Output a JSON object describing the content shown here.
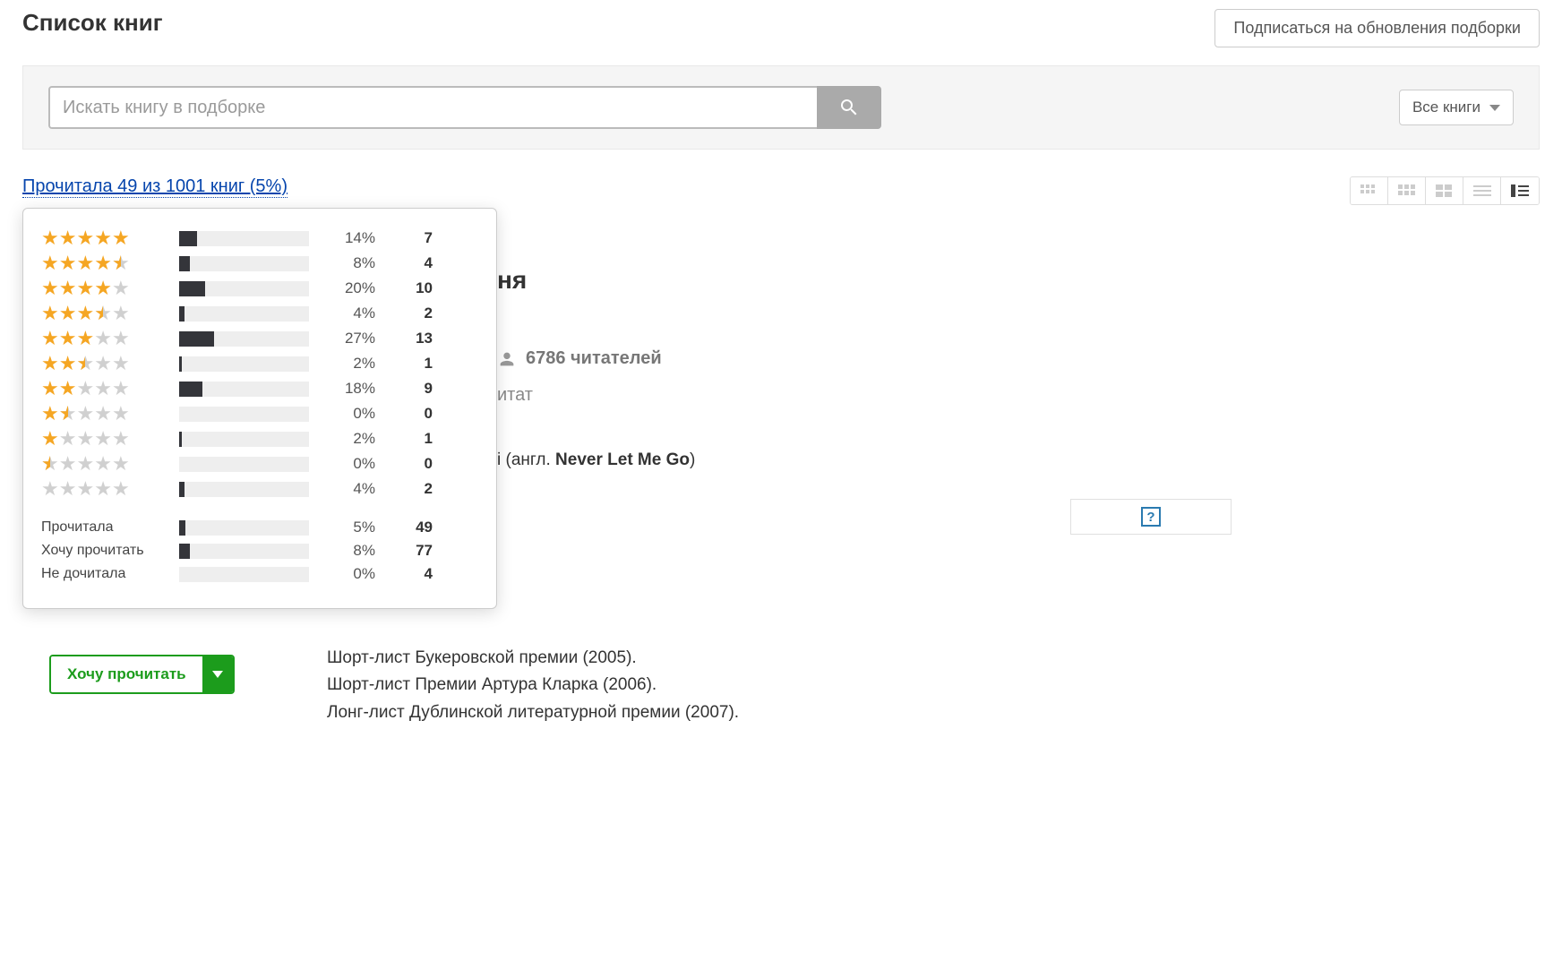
{
  "header": {
    "title": "Список книг",
    "subscribe": "Подписаться на обновления подборки"
  },
  "search": {
    "placeholder": "Искать книгу в подборке",
    "filter_label": "Все книги"
  },
  "progress_link": "Прочитала 49 из 1001 книг (5%)",
  "rating_rows": [
    {
      "stars_full": 5,
      "stars_half": 0,
      "pct": "14%",
      "cnt": "7",
      "bar": 14
    },
    {
      "stars_full": 4,
      "stars_half": 1,
      "pct": "8%",
      "cnt": "4",
      "bar": 8
    },
    {
      "stars_full": 4,
      "stars_half": 0,
      "pct": "20%",
      "cnt": "10",
      "bar": 20
    },
    {
      "stars_full": 3,
      "stars_half": 1,
      "pct": "4%",
      "cnt": "2",
      "bar": 4
    },
    {
      "stars_full": 3,
      "stars_half": 0,
      "pct": "27%",
      "cnt": "13",
      "bar": 27
    },
    {
      "stars_full": 2,
      "stars_half": 1,
      "pct": "2%",
      "cnt": "1",
      "bar": 2
    },
    {
      "stars_full": 2,
      "stars_half": 0,
      "pct": "18%",
      "cnt": "9",
      "bar": 18
    },
    {
      "stars_full": 1,
      "stars_half": 1,
      "pct": "0%",
      "cnt": "0",
      "bar": 0
    },
    {
      "stars_full": 1,
      "stars_half": 0,
      "pct": "2%",
      "cnt": "1",
      "bar": 2
    },
    {
      "stars_full": 0,
      "stars_half": 1,
      "pct": "0%",
      "cnt": "0",
      "bar": 0
    },
    {
      "stars_full": 0,
      "stars_half": 0,
      "pct": "4%",
      "cnt": "2",
      "bar": 4
    }
  ],
  "status_rows": [
    {
      "label": "Прочитала",
      "pct": "5%",
      "cnt": "49",
      "bar": 5
    },
    {
      "label": "Хочу прочитать",
      "pct": "8%",
      "cnt": "77",
      "bar": 8
    },
    {
      "label": "Не дочитала",
      "pct": "0%",
      "cnt": "4",
      "bar": 0
    }
  ],
  "content": {
    "title_suffix": "ня",
    "readers": "6786 читателей",
    "quotes": "итат",
    "eng_tail": "і (англ. ",
    "eng_strong": "Never Let Me Go",
    "eng_close": ")",
    "awards": [
      "Шорт-лист Букеровской премии (2005).",
      "Шорт-лист Премии Артура Кларка (2006).",
      "Лонг-лист Дублинской литературной премии (2007)."
    ]
  },
  "want_read": "Хочу прочитать",
  "img_placeholder": "?"
}
